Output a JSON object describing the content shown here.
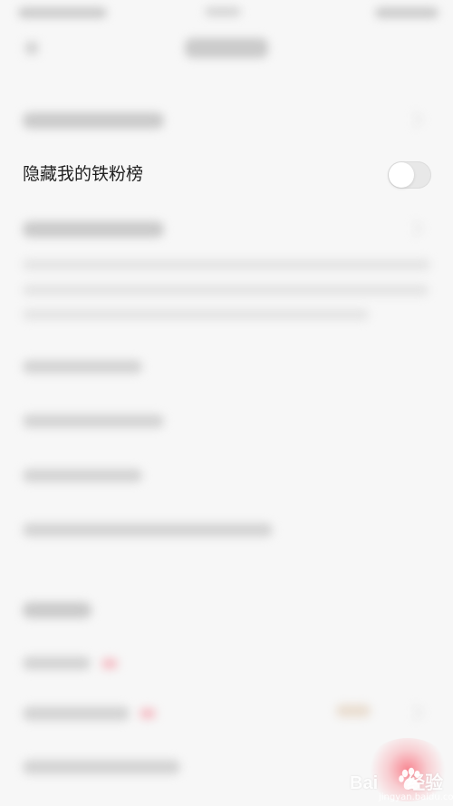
{
  "screen": {
    "visible_option_label": "隐藏我的铁粉榜",
    "toggle_state": "off"
  },
  "watermark": {
    "brand": "Bai",
    "brand_suffix": "经验",
    "url": "jingyan.baidu.com"
  },
  "colors": {
    "background": "#f7f7f7",
    "text": "#222222",
    "toggle_track": "#e8e8e8",
    "toggle_knob": "#ffffff",
    "accent_pink": "#f87481"
  }
}
